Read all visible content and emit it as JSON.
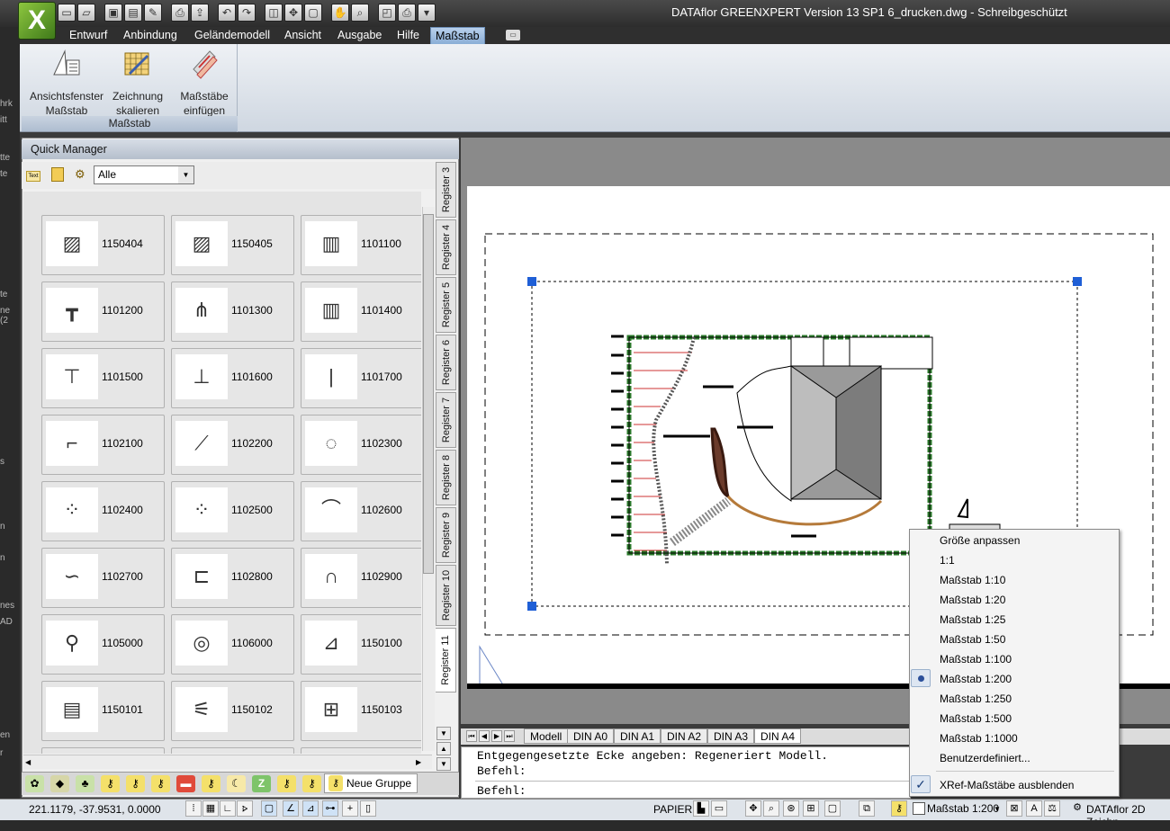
{
  "titlebar": {
    "title": "DATAflor GREENXPERT Version 13 SP1     6_drucken.dwg - Schreibgeschützt",
    "app_letter": "X"
  },
  "menu": [
    "Entwurf",
    "Anbindung",
    "Geländemodell",
    "Ansicht",
    "Ausgabe",
    "Hilfe",
    "Maßstab"
  ],
  "ribbon": {
    "buttons": [
      {
        "line1": "Ansichtsfenster",
        "line2": "Maßstab"
      },
      {
        "line1": "Zeichnung",
        "line2": "skalieren"
      },
      {
        "line1": "Maßstäbe",
        "line2": "einfügen"
      }
    ],
    "panel_title": "Maßstab"
  },
  "left_strip": [
    "hrk",
    "itt",
    "tte",
    "te",
    "ne (2",
    "te",
    "ne (2",
    "s",
    "n",
    "n",
    "nes",
    "AD",
    "en",
    "r"
  ],
  "quick_manager": {
    "title": "Quick Manager",
    "filter": "Alle",
    "tiles": [
      "1150404",
      "1150405",
      "1101100",
      "1101200",
      "1101300",
      "1101400",
      "1101500",
      "1101600",
      "1101700",
      "1102100",
      "1102200",
      "1102300",
      "1102400",
      "1102500",
      "1102600",
      "1102700",
      "1102800",
      "1102900",
      "1105000",
      "1106000",
      "1150100",
      "1150101",
      "1150102",
      "1150103"
    ],
    "registers": [
      "Register 3",
      "Register 4",
      "Register 5",
      "Register 6",
      "Register 7",
      "Register 8",
      "Register 9",
      "Register 10",
      "Register 11"
    ],
    "group_label": "Neue Gruppe"
  },
  "layout_tabs": [
    "Modell",
    "DIN A0",
    "DIN A1",
    "DIN A2",
    "DIN A3",
    "DIN A4"
  ],
  "command": {
    "line1": "Entgegengesetzte Ecke angeben: Regeneriert Modell.",
    "line2": "Befehl:",
    "line3": "Befehl:"
  },
  "status": {
    "coords": "221.1179, -37.9531, 0.0000",
    "papier": "PAPIER",
    "scale": "Maßstab 1:200",
    "product": "DATAflor 2D Zeichn"
  },
  "context_menu": {
    "items": [
      "Größe anpassen",
      "1:1",
      "Maßstab 1:10",
      "Maßstab 1:20",
      "Maßstab 1:25",
      "Maßstab 1:50",
      "Maßstab 1:100",
      "Maßstab 1:200",
      "Maßstab 1:250",
      "Maßstab 1:500",
      "Maßstab 1:1000",
      "Benutzerdefiniert..."
    ],
    "selected": "Maßstab 1:200",
    "checked_item": "XRef-Maßstäbe ausblenden"
  },
  "colors": {
    "accent": "#8aaed6",
    "app_green": "#6aa52e",
    "selection_grip": "#1f5fd6"
  }
}
